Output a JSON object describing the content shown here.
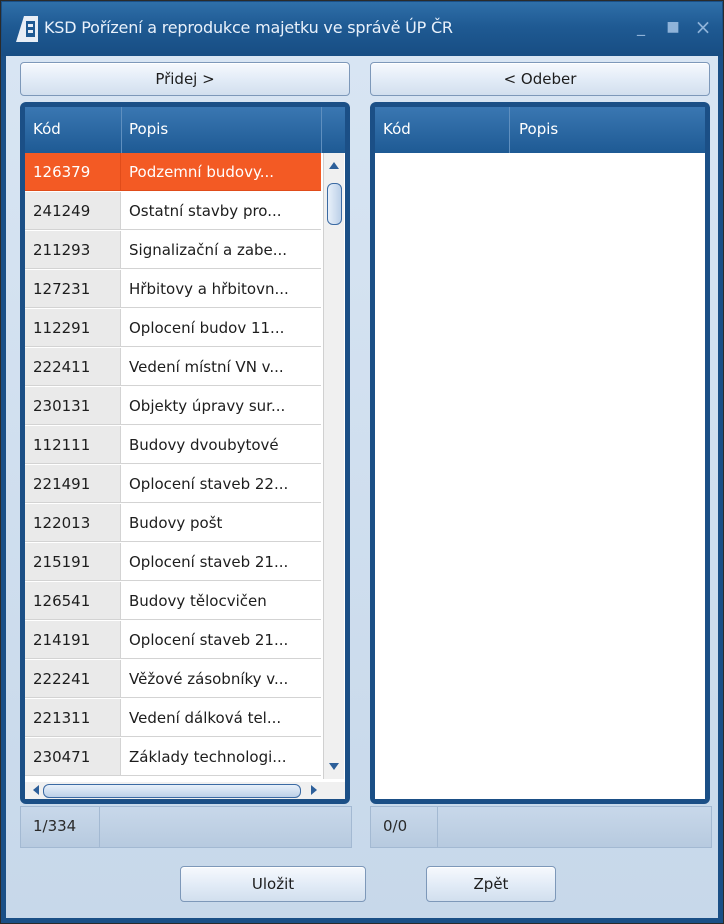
{
  "window": {
    "title": "KSD Pořízení a reprodukce majetku ve správě ÚP ČR",
    "minimize_glyph": "_",
    "maximize_glyph": "■",
    "close_glyph": "×"
  },
  "buttons": {
    "add": "Přidej >",
    "remove": "< Odeber",
    "save": "Uložit",
    "back": "Zpět"
  },
  "left_grid": {
    "columns": [
      "Kód",
      "Popis"
    ],
    "rows": [
      {
        "code": "126379",
        "desc": "Podzemní budovy...",
        "selected": true
      },
      {
        "code": "241249",
        "desc": "Ostatní stavby pro..."
      },
      {
        "code": "211293",
        "desc": "Signalizační a zabe..."
      },
      {
        "code": "127231",
        "desc": "Hřbitovy a hřbitovn..."
      },
      {
        "code": "112291",
        "desc": "Oplocení budov 11..."
      },
      {
        "code": "222411",
        "desc": "Vedení místní VN v..."
      },
      {
        "code": "230131",
        "desc": "Objekty úpravy sur..."
      },
      {
        "code": "112111",
        "desc": "Budovy dvoubytové"
      },
      {
        "code": "221491",
        "desc": "Oplocení staveb 22..."
      },
      {
        "code": "122013",
        "desc": "Budovy pošt"
      },
      {
        "code": "215191",
        "desc": "Oplocení staveb 21..."
      },
      {
        "code": "126541",
        "desc": "Budovy tělocvičen"
      },
      {
        "code": "214191",
        "desc": "Oplocení staveb 21..."
      },
      {
        "code": "222241",
        "desc": "Věžové zásobníky v..."
      },
      {
        "code": "221311",
        "desc": "Vedení dálková tel..."
      },
      {
        "code": "230471",
        "desc": "Základy technologi..."
      }
    ],
    "count": "1/334"
  },
  "right_grid": {
    "columns": [
      "Kód",
      "Popis"
    ],
    "rows": [],
    "count": "0/0"
  },
  "colors": {
    "titlebar": "#1f5a93",
    "selection": "#f35a24",
    "panel": "#1b4f86"
  }
}
